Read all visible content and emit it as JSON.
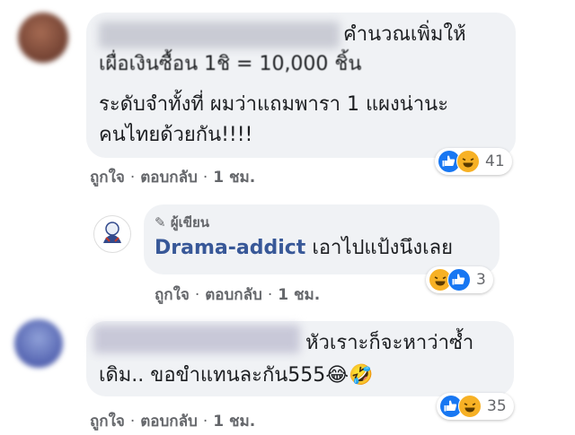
{
  "comments": [
    {
      "line1": "คำนวณเพิ่มให้",
      "line2": "เผื่อเงินซื้อน 1ชิ = 10,000 ชิ้น",
      "line3": "ระดับจำทั้งที่ ผมว่าแถมพารา 1 แผงน่านะ",
      "line4": "คนไทยด้วยกัน!!!!",
      "actions": {
        "like": "ถูกใจ",
        "reply": "ตอบกลับ",
        "time": "1 ชม."
      },
      "reactions": {
        "icons": [
          "like-icon",
          "haha-icon"
        ],
        "count": "41"
      }
    }
  ],
  "reply": {
    "author_badge": "ผู้เขียน",
    "author_name": "Drama-addict",
    "text": "เอาไปแป้งนึงเลย",
    "actions": {
      "like": "ถูกใจ",
      "reply": "ตอบกลับ",
      "time": "1 ชม."
    },
    "reactions": {
      "icons": [
        "haha-icon",
        "like-icon"
      ],
      "count": "3"
    }
  },
  "comment2": {
    "line1": "หัวเราะก็จะหาว่าซ้ำ",
    "line2": "เดิม.. ขอขำแทนละกัน555",
    "emoji": [
      "😂",
      "🤣"
    ],
    "actions": {
      "like": "ถูกใจ",
      "reply": "ตอบกลับ",
      "time": "1 ชม."
    },
    "reactions": {
      "icons": [
        "like-icon",
        "haha-icon"
      ],
      "count": "35"
    }
  },
  "colors": {
    "like_blue": "#1877f2",
    "haha_yellow": "#f7b125",
    "bubble": "#f0f2f5",
    "meta": "#65676b"
  }
}
